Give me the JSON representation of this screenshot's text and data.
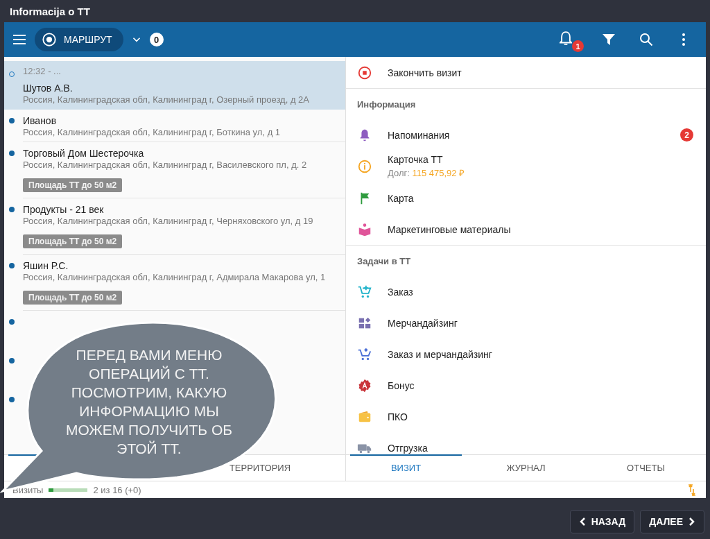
{
  "window": {
    "title": "Informacija o TT"
  },
  "toolbar": {
    "route_label": "МАРШРУТ",
    "count": "0",
    "notification_badge": "1"
  },
  "route_list": [
    {
      "time": "12:32 - ...",
      "name": "Шутов А.В.",
      "address": "Россия, Калининградская обл, Калининград г, Озерный проезд, д 2А",
      "selected": true
    },
    {
      "name": "Иванов",
      "address": "Россия, Калининградская обл, Калининград г, Боткина ул, д 1",
      "selected": false
    },
    {
      "name": "Торговый Дом Шестерочка",
      "address": "Россия, Калининградская обл, Калининград г, Василевского пл, д. 2",
      "tag": "Площадь ТТ до 50 м2",
      "selected": false
    },
    {
      "name": "Продукты - 21 век",
      "address": "Россия, Калининградская обл, Калининград г, Черняховского ул, д 19",
      "tag": "Площадь ТТ до 50 м2",
      "selected": false
    },
    {
      "name": "Яшин Р.С.",
      "address": "Россия, Калининградская обл, Калининград г, Адмирала Макарова ул, 1",
      "tag": "Площадь ТТ до 50 м2",
      "selected": false
    },
    {
      "selected": false
    },
    {
      "selected": false
    },
    {
      "selected": false
    }
  ],
  "left_tabs": [
    {
      "selected": true
    },
    {
      "label": "ТЕРРИТОРИЯ",
      "selected": false
    }
  ],
  "status_bar": {
    "label": "Визиты",
    "level": 0.12,
    "reading": "2 из 16 (+0)"
  },
  "end_visit": {
    "label": "Закончить визит"
  },
  "menu_sections": [
    {
      "title": "Информация",
      "items": [
        {
          "label": "Напоминания",
          "badge": "2"
        },
        {
          "label": "Карточка ТТ",
          "detail_label": "Долг:",
          "detail_value": "115 475,92 ₽"
        },
        {
          "label": "Карта"
        },
        {
          "label": "Маркетинговые материалы"
        }
      ]
    },
    {
      "title": "Задачи в ТТ",
      "items": [
        {
          "label": "Заказ"
        },
        {
          "label": "Мерчандайзинг"
        },
        {
          "label": "Заказ и мерчандайзинг"
        },
        {
          "label": "Бонус"
        },
        {
          "label": "ПКО"
        },
        {
          "label": "Отгрузка"
        }
      ]
    }
  ],
  "right_tabs": [
    {
      "label": "ВИЗИТ",
      "selected": true
    },
    {
      "label": "ЖУРНАЛ",
      "selected": false
    },
    {
      "label": "ОТЧЕТЫ",
      "selected": false
    }
  ],
  "callout": {
    "text": "ПЕРЕД ВАМИ МЕНЮ ОПЕРАЦИЙ С ТТ. ПОСМОТРИМ, КАКУЮ ИНФОРМАЦИЮ МЫ МОЖЕМ ПОЛУЧИТЬ ОБ ЭТОЙ ТТ."
  },
  "nav_buttons": [
    {
      "label": "НАЗАД",
      "kind": "back"
    },
    {
      "label": "ДАЛЕЕ",
      "kind": "next"
    }
  ]
}
